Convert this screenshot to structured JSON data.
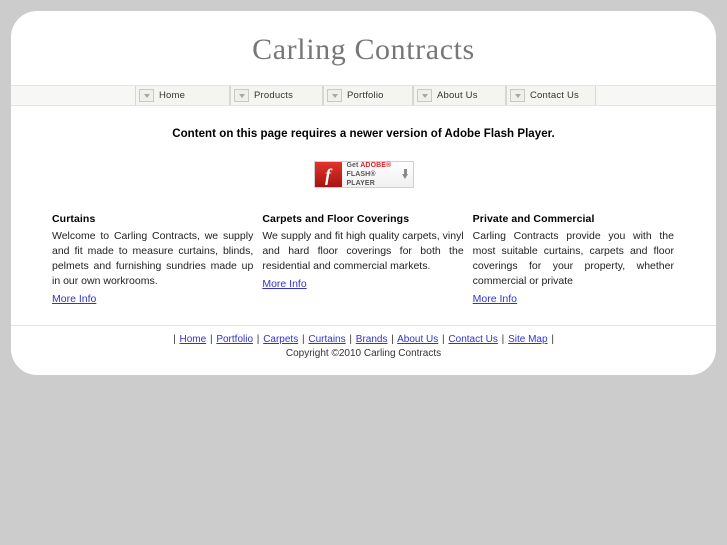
{
  "page": {
    "background_color": "#cccccc",
    "container_color": "#ffffff",
    "link_color": "#3333cc"
  },
  "header": {
    "title": "Carling Contracts"
  },
  "nav": {
    "items": [
      {
        "label": "Home",
        "icon": "chevron-down-icon"
      },
      {
        "label": "Products",
        "icon": "chevron-down-icon"
      },
      {
        "label": "Portfolio",
        "icon": "chevron-down-icon"
      },
      {
        "label": "About Us",
        "icon": "chevron-down-icon"
      },
      {
        "label": "Contact Us",
        "icon": "chevron-down-icon"
      }
    ]
  },
  "notice": {
    "text": "Content on this page requires a newer version of Adobe Flash Player."
  },
  "flash_badge": {
    "icon": "flash-player-icon",
    "glyph": "f",
    "line1_prefix": "Get ",
    "line1_brand": "ADOBE®",
    "line2": "FLASH® PLAYER",
    "download_icon": "download-arrow-icon",
    "brand_color": "#d81f26"
  },
  "columns": [
    {
      "heading": "Curtains",
      "body": "Welcome to Carling Contracts, we supply and fit made to measure curtains, blinds, pelmets and furnishing sundries made up in our own workrooms.",
      "link_label": "More Info"
    },
    {
      "heading": "Carpets and Floor Coverings",
      "body": "We supply and fit high quality carpets, vinyl and hard floor coverings for both the residential and commercial markets.",
      "link_label": "More Info"
    },
    {
      "heading": "Private and Commercial",
      "body": "Carling Contracts provide you with the most suitable curtains, carpets and floor coverings for your property, whether commercial or private",
      "link_label": "More Info"
    }
  ],
  "footer": {
    "separator": "|",
    "links": [
      {
        "label": "Home"
      },
      {
        "label": "Portfolio"
      },
      {
        "label": "Carpets"
      },
      {
        "label": "Curtains"
      },
      {
        "label": "Brands"
      },
      {
        "label": "About Us"
      },
      {
        "label": "Contact Us"
      },
      {
        "label": "Site Map"
      }
    ],
    "copyright": "Copyright ©2010 Carling Contracts"
  }
}
